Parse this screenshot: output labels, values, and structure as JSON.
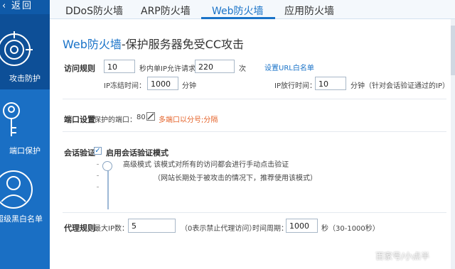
{
  "sidebar": {
    "back_label": "返回",
    "items": [
      {
        "label": "攻击防护",
        "icon": "target-icon",
        "active": true
      },
      {
        "label": "端口保护",
        "icon": "key-icon",
        "active": false
      },
      {
        "label": "超级黑白名单",
        "icon": "user-icon",
        "active": false
      }
    ]
  },
  "tabs": [
    {
      "label": "DDoS防火墙"
    },
    {
      "label": "ARP防火墙"
    },
    {
      "label": "Web防火墙",
      "active": true
    },
    {
      "label": "应用防火墙"
    }
  ],
  "heading": {
    "brand": "Web防火墙",
    "rest": "-保护服务器免受CC攻击"
  },
  "access_rule": {
    "label": "访问规则",
    "seconds_value": "10",
    "seconds_text": "秒内单IP允许请求",
    "requests_value": "220",
    "times_text": "次",
    "whitelist_link": "设置URL白名单",
    "freeze_label": "IP冻结时间：",
    "freeze_value": "1000",
    "freeze_unit": "分钟",
    "release_label": "IP放行时间：",
    "release_value": "10",
    "release_unit": "分钟（针对会话验证通过的IP）"
  },
  "port_setting": {
    "label": "端口设置",
    "protected_label": "保护的端口：",
    "port_value": "80",
    "hint": "多端口以分号;分隔"
  },
  "session_verify": {
    "label": "会话验证",
    "checkbox_label": "启用会话验证模式",
    "checked": true,
    "mode_text": "高级模式  该模式对所有的访问都会进行手动点击验证",
    "mode_hint": "（网站长期处于被攻击的情况下，推荐使用该模式）"
  },
  "proxy_rule": {
    "label": "代理规则",
    "max_ip_label": "最大IP数：",
    "max_ip_value": "5",
    "max_ip_hint": "（0表示禁止代理访问）",
    "period_label": "时间周期：",
    "period_value": "1000",
    "period_unit": "秒（30-1000秒）"
  },
  "watermark": "百家号/小点半",
  "colors": {
    "sidebar": "#1a6fc4",
    "accent": "#1a73c8",
    "hint": "#e5632a"
  }
}
